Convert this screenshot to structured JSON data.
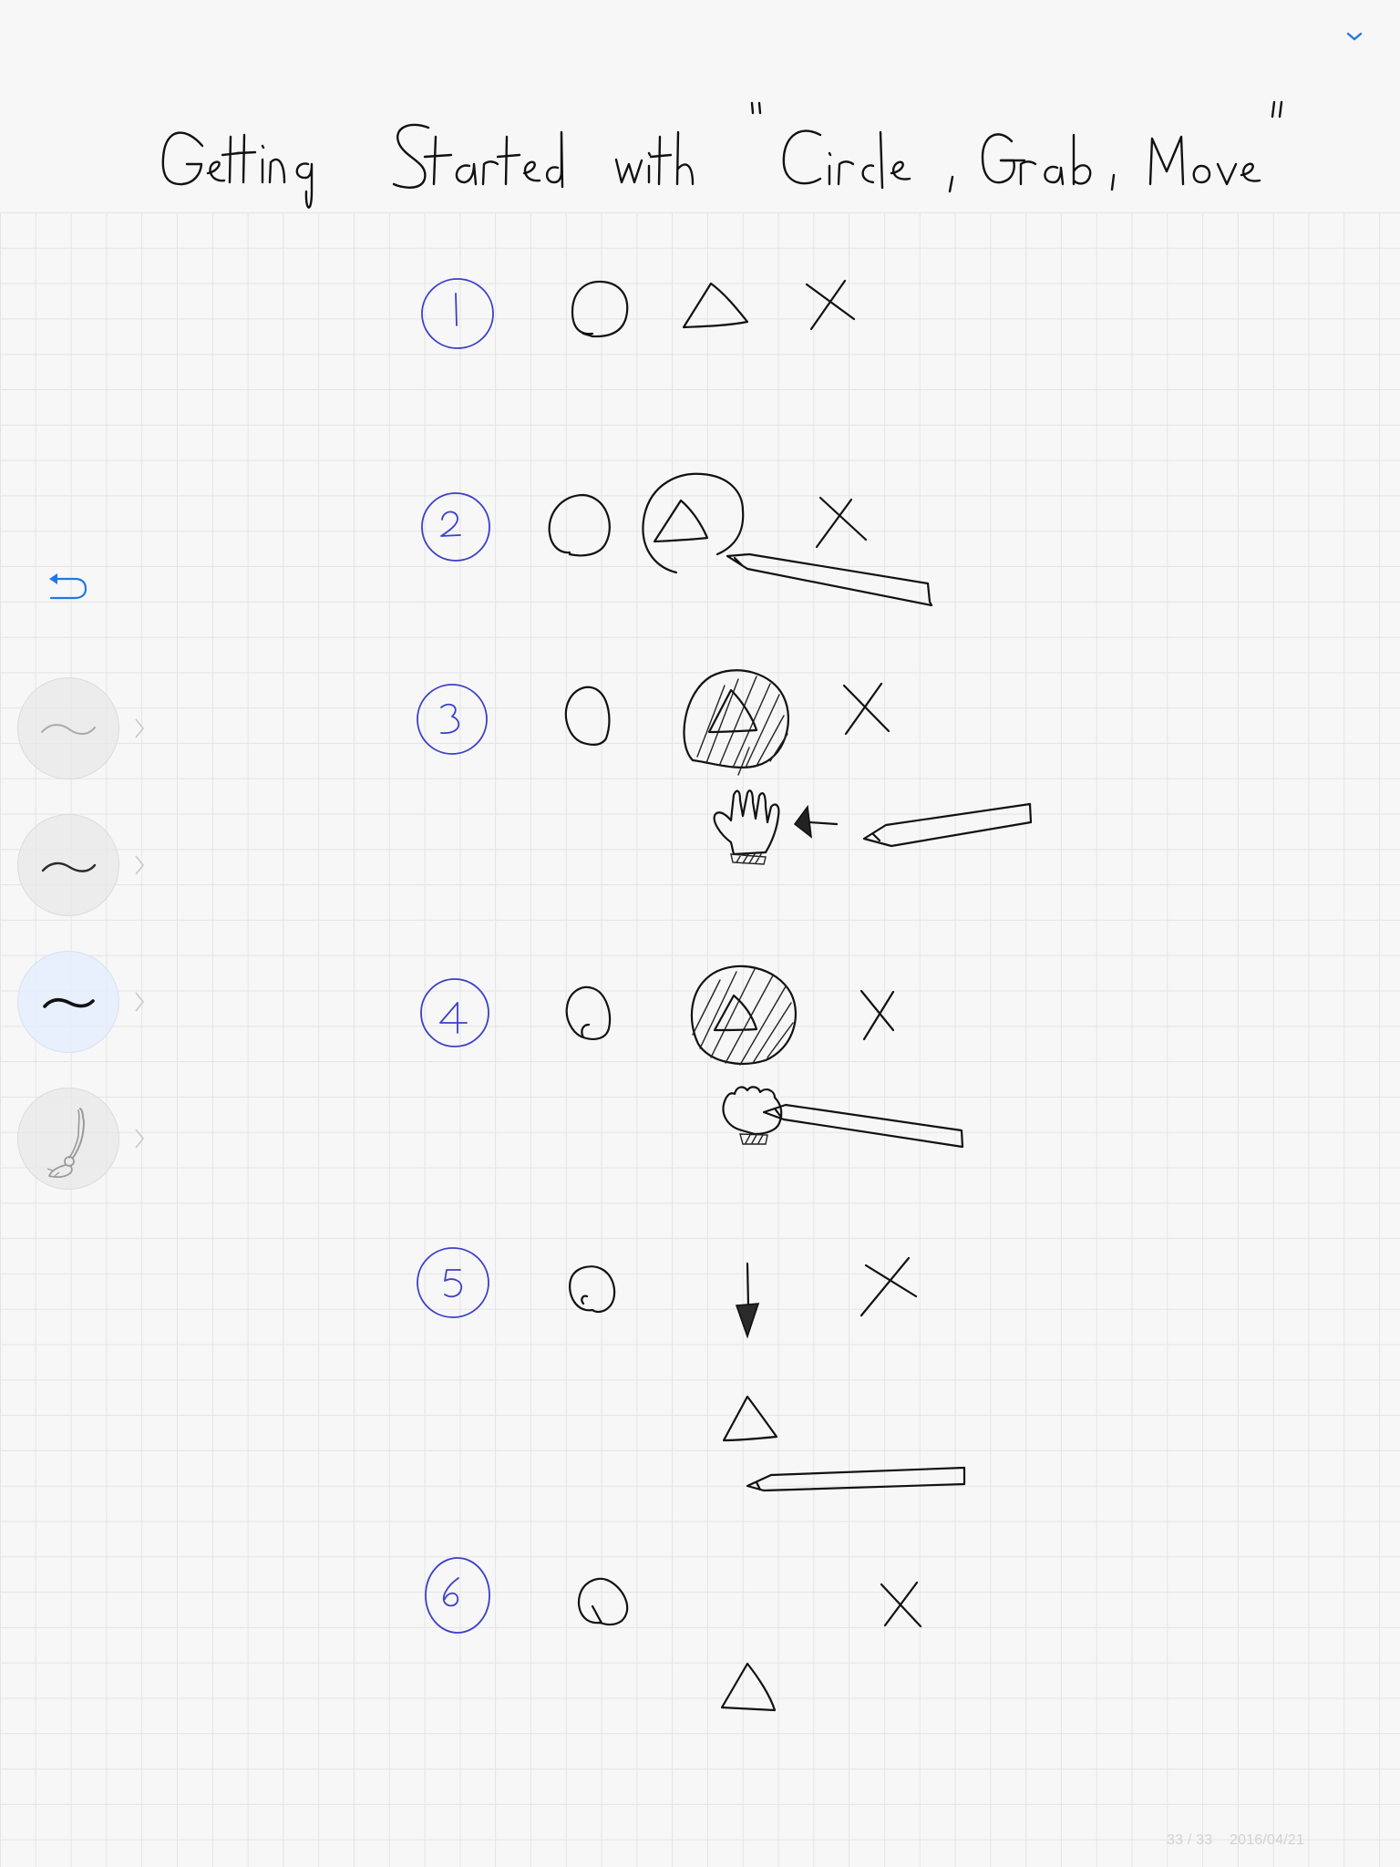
{
  "app": {
    "page_title": "Getting Started with \"Circle, Grab, Move\"",
    "page_counter": "33 / 33",
    "date": "2016/04/21",
    "accent_color": "#1e78e6",
    "step_ink_color": "#3c3fc9"
  },
  "toolbar": {
    "collapse_icon": "chevron-down-icon",
    "undo_icon": "undo-icon",
    "tools": [
      {
        "name": "thin-pen",
        "icon": "thin-stroke-icon",
        "selected": false
      },
      {
        "name": "medium-pen",
        "icon": "medium-stroke-icon",
        "selected": false
      },
      {
        "name": "thick-pen",
        "icon": "thick-stroke-icon",
        "selected": true
      },
      {
        "name": "eraser-broom",
        "icon": "broom-icon",
        "selected": false
      }
    ]
  },
  "steps": [
    {
      "number": "1",
      "description": "circle, triangle and cross drawn"
    },
    {
      "number": "2",
      "description": "pencil draws a circle around the triangle"
    },
    {
      "number": "3",
      "description": "circled area is filled; hand grabs with pencil tap"
    },
    {
      "number": "4",
      "description": "hand holds selection with pencil"
    },
    {
      "number": "5",
      "description": "selection moved downward with arrow"
    },
    {
      "number": "6",
      "description": "triangle placed at new position"
    }
  ]
}
